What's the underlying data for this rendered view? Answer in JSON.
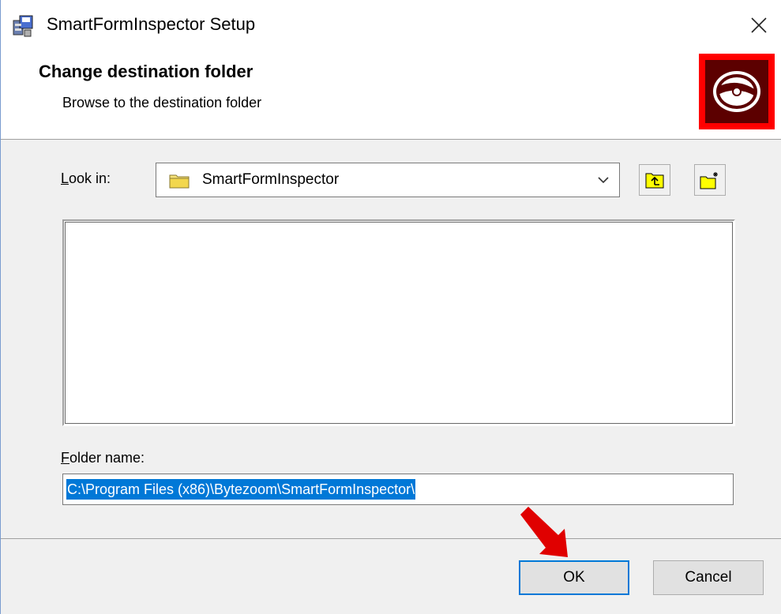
{
  "window": {
    "title": "SmartFormInspector Setup",
    "close_icon": "close-icon"
  },
  "header": {
    "title": "Change destination folder",
    "subtitle": "Browse to the destination folder",
    "banner_icon": "disc-icon"
  },
  "look_in": {
    "label_accel": "L",
    "label_rest": "ook in:",
    "value": "SmartFormInspector",
    "up_button_icon": "folder-up-icon",
    "new_folder_button_icon": "new-folder-icon"
  },
  "folder_name": {
    "label_accel": "F",
    "label_rest": "older name:",
    "value": "C:\\Program Files (x86)\\Bytezoom\\SmartFormInspector\\"
  },
  "buttons": {
    "ok": "OK",
    "cancel": "Cancel"
  },
  "colors": {
    "selection": "#0078d7",
    "banner_red": "#ff0000",
    "annotation_arrow": "#e00000"
  }
}
